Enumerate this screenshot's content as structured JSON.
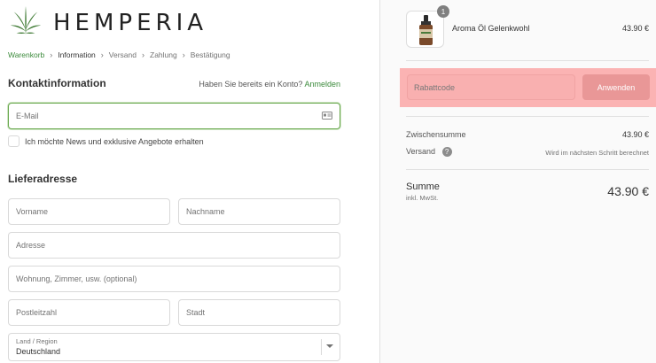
{
  "brand": {
    "name": "HEMPERIA",
    "accent": "#3b8a3b"
  },
  "breadcrumb": [
    {
      "label": "Warenkorb",
      "state": "link"
    },
    {
      "label": "Information",
      "state": "current"
    },
    {
      "label": "Versand",
      "state": "upcoming"
    },
    {
      "label": "Zahlung",
      "state": "upcoming"
    },
    {
      "label": "Bestätigung",
      "state": "upcoming"
    }
  ],
  "contact": {
    "title": "Kontaktinformation",
    "have_account": "Haben Sie bereits ein Konto?",
    "login_link": "Anmelden",
    "email_placeholder": "E-Mail",
    "newsletter_label": "Ich möchte News und exklusive Angebote erhalten"
  },
  "shipping": {
    "title": "Lieferadresse",
    "first_name": "Vorname",
    "last_name": "Nachname",
    "address": "Adresse",
    "apartment": "Wohnung, Zimmer, usw. (optional)",
    "postal_code": "Postleitzahl",
    "city": "Stadt",
    "country_label": "Land / Region",
    "country_value": "Deutschland"
  },
  "summary": {
    "product": {
      "name": "Aroma Öl Gelenkwohl",
      "price": "43.90 €",
      "quantity": "1"
    },
    "discount_placeholder": "Rabattcode",
    "apply_label": "Anwenden",
    "subtotal_label": "Zwischensumme",
    "subtotal_value": "43.90 €",
    "shipping_label": "Versand",
    "shipping_value": "Wird im nächsten Schritt berechnet",
    "total_label": "Summe",
    "total_sub": "inkl. MwSt.",
    "total_value": "43.90 €"
  }
}
